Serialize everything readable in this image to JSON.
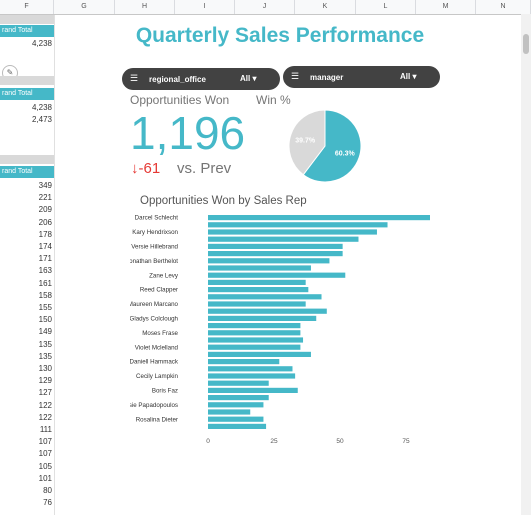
{
  "columns": [
    "F",
    "G",
    "H",
    "I",
    "J",
    "K",
    "L",
    "M",
    "N"
  ],
  "left_sheet": {
    "header1": "rand Total",
    "value1": "4,238",
    "header2": "rand Total",
    "values2": [
      "4,238",
      "2,473"
    ],
    "header3": "rand Total",
    "values3": [
      "349",
      "221",
      "209",
      "206",
      "178",
      "174",
      "171",
      "163",
      "161",
      "158",
      "155",
      "150",
      "149",
      "135",
      "135",
      "130",
      "129",
      "127",
      "122",
      "122",
      "111",
      "107",
      "107",
      "105",
      "101",
      "80",
      "76"
    ]
  },
  "dashboard": {
    "title": "Quarterly Sales Performance",
    "filters": [
      {
        "name": "regional_office",
        "value": "All ▾"
      },
      {
        "name": "manager",
        "value": "All ▾"
      }
    ],
    "kpi": {
      "label": "Opportunities Won",
      "value": "1,196",
      "delta": "-61",
      "delta_suffix": "vs. Prev"
    },
    "win_pct": {
      "label": "Win %",
      "won_label": "60.3%",
      "lost_label": "39.7%"
    }
  },
  "chart_data": [
    {
      "type": "pie",
      "title": "Win %",
      "slices": [
        {
          "label": "60.3%",
          "value": 60.3,
          "color": "#45b8c8"
        },
        {
          "label": "39.7%",
          "value": 39.7,
          "color": "#d9d9d9"
        }
      ]
    },
    {
      "type": "bar",
      "orientation": "horizontal",
      "title": "Opportunities Won by Sales Rep",
      "xlim": [
        0,
        100
      ],
      "xticks": [
        0,
        25,
        50,
        75,
        100
      ],
      "color": "#45b8c8",
      "categories": [
        "Darcel Schlecht",
        "",
        "Kary Hendrixson",
        "",
        "Versie Hillebrand",
        "",
        "Jonathan Berthelot",
        "",
        "Zane Levy",
        "",
        "Reed Clapper",
        "",
        "Maureen Marcano",
        "",
        "Gladys Colclough",
        "",
        "Moses Frase",
        "",
        "Violet Mclelland",
        "",
        "Daniell Hammack",
        "",
        "Cecily Lampkin",
        "",
        "Boris Faz",
        "",
        "Rosie Papadopoulos",
        "",
        "Rosalina Dieter"
      ],
      "values": [
        94,
        68,
        64,
        57,
        51,
        51,
        46,
        39,
        52,
        37,
        38,
        43,
        37,
        45,
        41,
        35,
        35,
        36,
        35,
        39,
        27,
        32,
        33,
        23,
        34,
        23,
        21,
        16,
        21,
        22
      ]
    }
  ]
}
